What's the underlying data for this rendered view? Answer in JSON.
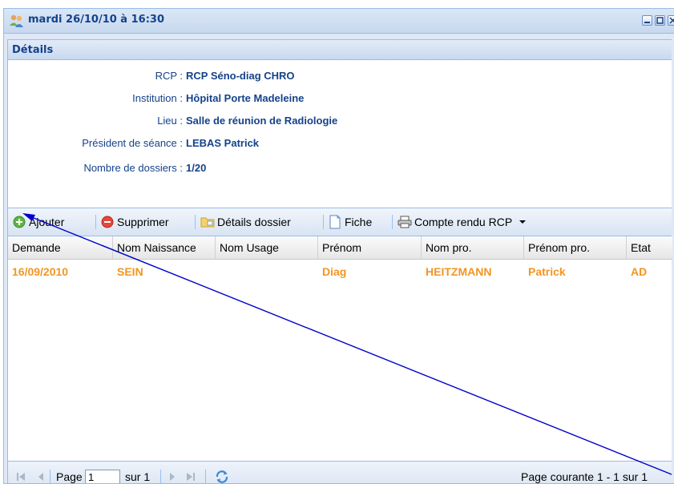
{
  "window": {
    "title": "mardi 26/10/10 à 16:30"
  },
  "panel": {
    "title": "Détails"
  },
  "details": [
    {
      "label": "RCP :",
      "value": "RCP Séno-diag CHRO"
    },
    {
      "label": "Institution :",
      "value": "Hôpital Porte Madeleine"
    },
    {
      "label": "Lieu :",
      "value": "Salle de réunion de Radiologie"
    },
    {
      "label": "Président de séance :",
      "value": "LEBAS Patrick"
    },
    {
      "label": "Nombre de dossiers :",
      "value": "1/20"
    }
  ],
  "toolbar": {
    "add": "Ajouter",
    "delete": "Supprimer",
    "details": "Détails dossier",
    "sheet": "Fiche",
    "report": "Compte rendu RCP"
  },
  "grid": {
    "columns": [
      "Demande",
      "Nom Naissance",
      "Nom Usage",
      "Prénom",
      "Nom pro.",
      "Prénom pro.",
      "Etat"
    ],
    "rows": [
      [
        "16/09/2010",
        "SEIN",
        "",
        "Diag",
        "HEITZMANN",
        "Patrick",
        "AD"
      ]
    ]
  },
  "pager": {
    "page_label": "Page",
    "page_value": "1",
    "of_label": "sur 1",
    "status": "Page courante 1 - 1 sur 1"
  },
  "colors": {
    "header_text": "#15428b",
    "row_text": "#f39522",
    "annotation_arrow": "#0000cc"
  }
}
